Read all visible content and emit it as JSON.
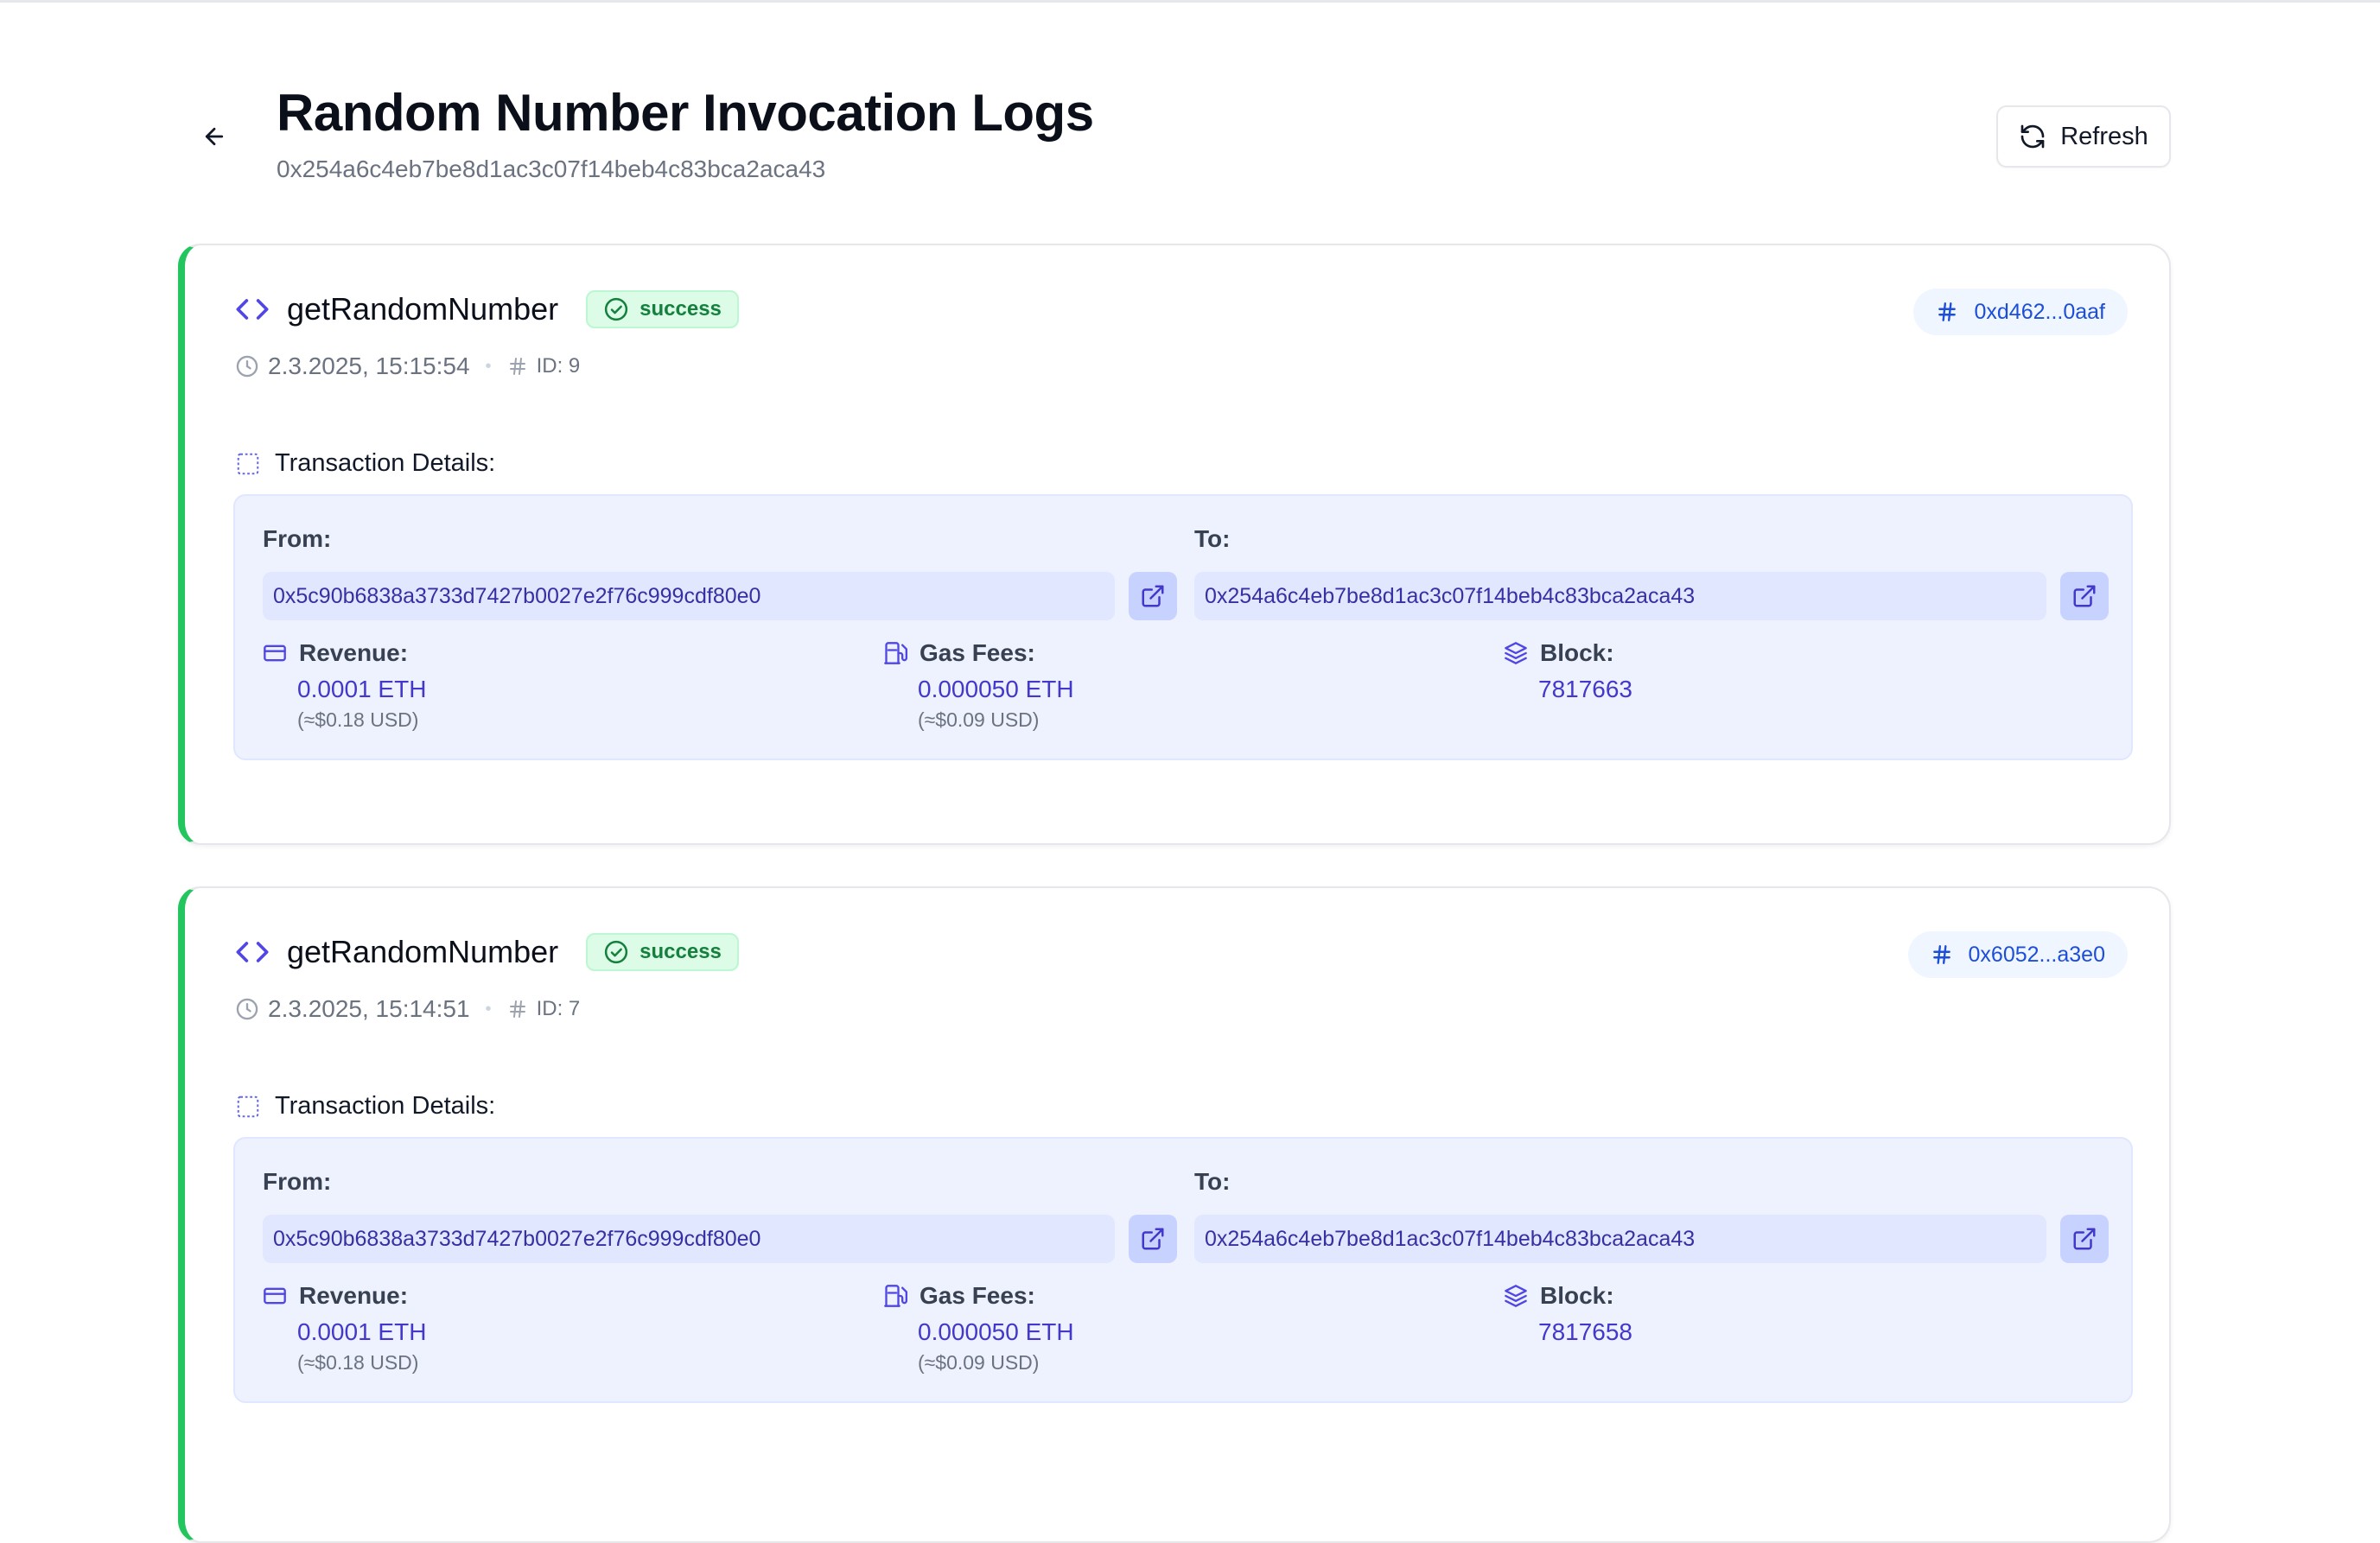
{
  "header": {
    "title": "Random Number Invocation Logs",
    "contract_address": "0x254a6c4eb7be8d1ac3c07f14beb4c83bca2aca43",
    "refresh_label": "Refresh"
  },
  "logs": [
    {
      "function_name": "getRandomNumber",
      "status": "success",
      "timestamp": "2.3.2025, 15:15:54",
      "id_label": "ID: 9",
      "tx_hash_short": "0xd462...0aaf",
      "details_label": "Transaction Details:",
      "from_label": "From:",
      "from_address": "0x5c90b6838a3733d7427b0027e2f76c999cdf80e0",
      "to_label": "To:",
      "to_address": "0x254a6c4eb7be8d1ac3c07f14beb4c83bca2aca43",
      "revenue_label": "Revenue:",
      "revenue_value": "0.0001 ETH",
      "revenue_usd": "(≈$0.18 USD)",
      "gas_label": "Gas Fees:",
      "gas_value": "0.000050 ETH",
      "gas_usd": "(≈$0.09 USD)",
      "block_label": "Block:",
      "block_value": "7817663"
    },
    {
      "function_name": "getRandomNumber",
      "status": "success",
      "timestamp": "2.3.2025, 15:14:51",
      "id_label": "ID: 7",
      "tx_hash_short": "0x6052...a3e0",
      "details_label": "Transaction Details:",
      "from_label": "From:",
      "from_address": "0x5c90b6838a3733d7427b0027e2f76c999cdf80e0",
      "to_label": "To:",
      "to_address": "0x254a6c4eb7be8d1ac3c07f14beb4c83bca2aca43",
      "revenue_label": "Revenue:",
      "revenue_value": "0.0001 ETH",
      "revenue_usd": "(≈$0.18 USD)",
      "gas_label": "Gas Fees:",
      "gas_value": "0.000050 ETH",
      "gas_usd": "(≈$0.09 USD)",
      "block_label": "Block:",
      "block_value": "7817658"
    }
  ],
  "colors": {
    "accent_green": "#22c55e",
    "accent_indigo": "#4f46e5",
    "panel_bg": "#eef2ff"
  },
  "icons": [
    "arrow-left-icon",
    "refresh-icon",
    "code-icon",
    "check-circle-icon",
    "clock-icon",
    "hash-icon",
    "dashed-square-icon",
    "external-link-icon",
    "credit-card-icon",
    "fuel-icon",
    "layers-icon"
  ]
}
